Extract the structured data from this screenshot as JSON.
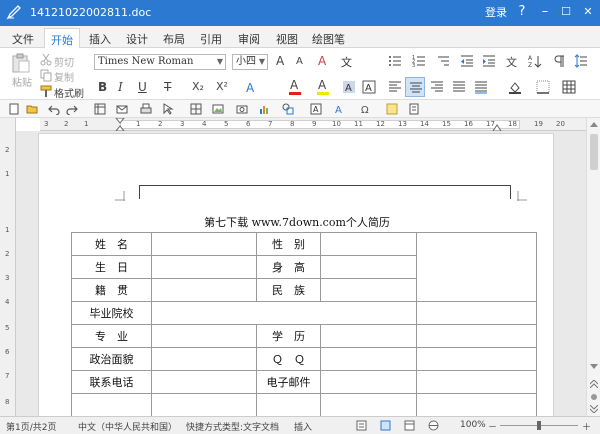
{
  "window": {
    "title": "14121022002811.doc",
    "login": "登录",
    "help": "?",
    "minimize": "–",
    "maximize": "☐",
    "close": "✕"
  },
  "tabs": [
    "文件",
    "开始",
    "插入",
    "设计",
    "布局",
    "引用",
    "审阅",
    "视图",
    "绘图笔"
  ],
  "ribbon": {
    "paste": "粘贴",
    "cut": "剪切",
    "copy": "复制",
    "format_painter": "格式刷",
    "font_name": "Times New Roman",
    "font_size": "小四",
    "bold": "B",
    "italic": "I",
    "underline": "U",
    "strike": "T",
    "subscript": "X₂",
    "superscript": "X²",
    "font_color": "A",
    "highlight": "A",
    "grow": "A",
    "shrink": "A",
    "clear": "A"
  },
  "ruler": {
    "top_numbers": [
      "3",
      "2",
      "1",
      "1",
      "2",
      "3",
      "4",
      "5",
      "6",
      "7",
      "8",
      "9",
      "10",
      "11",
      "12",
      "13",
      "14",
      "15",
      "16",
      "17",
      "18",
      "19",
      "20"
    ],
    "left_numbers": [
      "2",
      "1",
      "1",
      "2",
      "3",
      "4",
      "5",
      "6",
      "7",
      "8"
    ]
  },
  "document": {
    "title": "第七下载 www.7down.com个人简历",
    "rows": [
      {
        "l1": "姓　名",
        "l2": "性　别"
      },
      {
        "l1": "生　日",
        "l2": "身　高"
      },
      {
        "l1": "籍　贯",
        "l2": "民　族"
      },
      {
        "l1": "毕业院校",
        "l2": ""
      },
      {
        "l1": "专　业",
        "l2": "学　历"
      },
      {
        "l1": "政治面貌",
        "l2": "Ｑ　Ｑ"
      },
      {
        "l1": "联系电话",
        "l2": "电子邮件"
      },
      {
        "l1": "",
        "l2": ""
      }
    ]
  },
  "status": {
    "page": "第1页/共2页",
    "language": "中文（中华人民共和国）",
    "doc_type": "快捷方式类型:文字文档",
    "insert_mode": "插入",
    "zoom": "100%",
    "zoom_out": "－",
    "zoom_in": "＋"
  },
  "colors": {
    "accent": "#2b79d0",
    "font_color": "#e02020",
    "highlight": "#f2e600"
  }
}
